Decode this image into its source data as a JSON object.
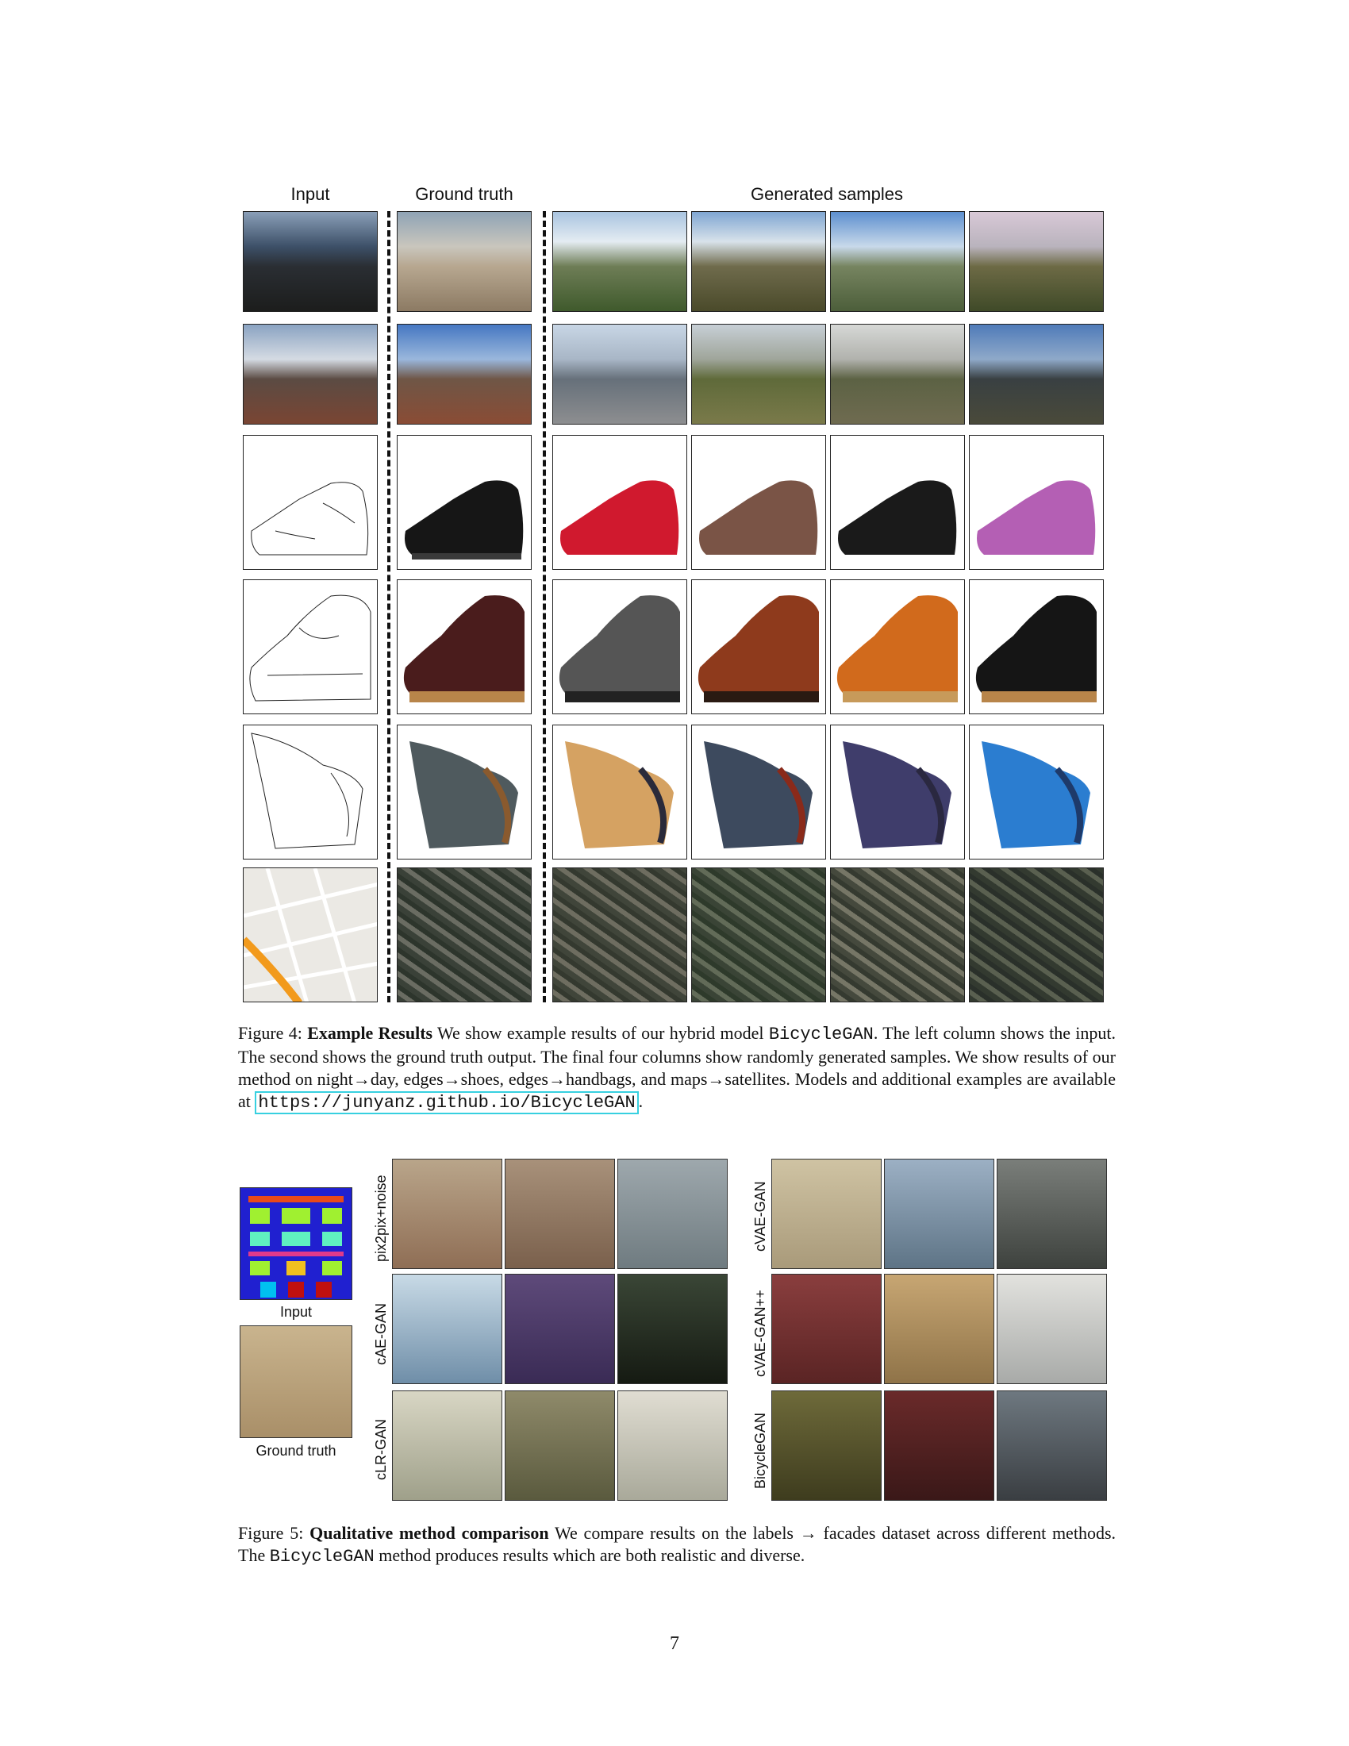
{
  "figure4": {
    "col_input": "Input",
    "col_gt": "Ground truth",
    "col_samples": "Generated samples",
    "caption_prefix": "Figure 4:",
    "caption_bold": "Example Results",
    "caption_text_1": " We show example results of our hybrid model ",
    "caption_model": "BicycleGAN",
    "caption_text_2": ". The left column shows the input. The second shows the ground truth output. The final four columns show randomly generated samples. We show results of our method on night→day, edges→shoes, edges→handbags, and maps→satellites. Models and additional examples are available at ",
    "caption_url": "https://junyanz.github.io/BicycleGAN",
    "caption_end": ".",
    "rows": [
      "night-day-1",
      "night-day-2",
      "edges-shoes-1",
      "edges-shoes-2",
      "edges-handbags",
      "maps-satellites"
    ]
  },
  "figure5": {
    "input_label": "Input",
    "gt_label": "Ground truth",
    "method_left": [
      "pix2pix+noise",
      "cAE-GAN",
      "cLR-GAN"
    ],
    "method_right": [
      "cVAE-GAN",
      "cVAE-GAN++",
      "BicycleGAN"
    ],
    "caption_prefix": "Figure 5:",
    "caption_bold": "Qualitative method comparison",
    "caption_text_1": " We compare results on the labels → facades dataset across different methods. The ",
    "caption_model": "BicycleGAN",
    "caption_text_2": " method produces results which are both realistic and diverse."
  },
  "page_number": "7"
}
